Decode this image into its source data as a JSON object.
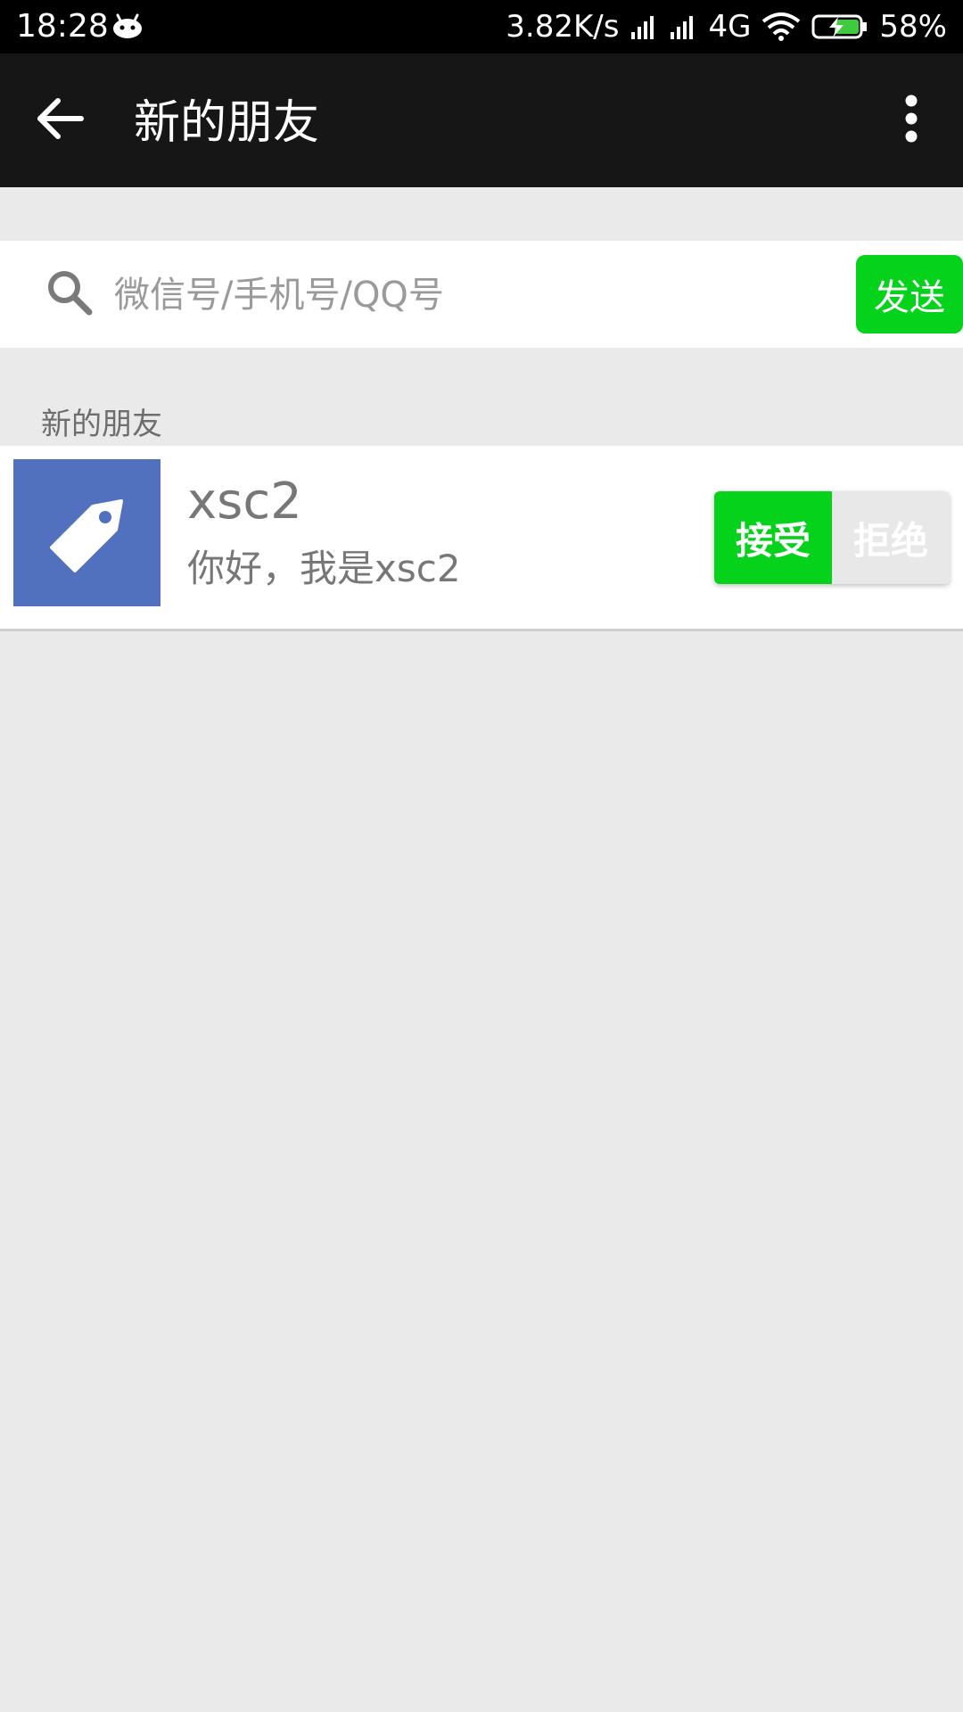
{
  "status_bar": {
    "time": "18:28",
    "app_icon": "android-icon",
    "net_speed": "3.82K/s",
    "network": "4G",
    "battery": "58%"
  },
  "app_bar": {
    "back_icon": "arrow-left-icon",
    "title": "新的朋友",
    "more_icon": "more-vertical-icon"
  },
  "search": {
    "placeholder": "微信号/手机号/QQ号",
    "value": "",
    "send_label": "发送"
  },
  "section": {
    "title": "新的朋友"
  },
  "requests": [
    {
      "name": "xsc2",
      "message": "你好，我是xsc2",
      "avatar_icon": "tag-icon",
      "accept_label": "接受",
      "reject_label": "拒绝"
    }
  ],
  "colors": {
    "accent_green": "#05d31b",
    "avatar_blue": "#5171be",
    "app_bar": "#161616",
    "background": "#eaeaea"
  }
}
